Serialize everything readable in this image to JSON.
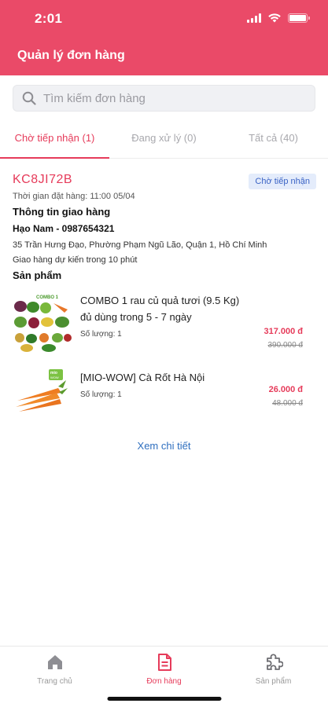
{
  "status_bar": {
    "time": "2:01"
  },
  "header": {
    "title": "Quản lý đơn hàng"
  },
  "search": {
    "placeholder": "Tìm kiếm đơn hàng"
  },
  "tabs": [
    {
      "label": "Chờ tiếp nhận (1)",
      "active": true
    },
    {
      "label": "Đang xử lý (0)",
      "active": false
    },
    {
      "label": "Tất cả (40)",
      "active": false
    }
  ],
  "order": {
    "code": "KC8JI72B",
    "status_badge": "Chờ tiếp nhận",
    "order_time": "Thời gian đặt hàng: 11:00 05/04",
    "delivery_title": "Thông tin giao hàng",
    "customer": "Hạo Nam - 0987654321",
    "address": "35 Trần Hưng Đạo, Phường Phạm Ngũ Lão,  Quận 1, Hồ Chí Minh",
    "eta": "Giao hàng dự kiến trong 10 phút",
    "products_title": "Sản phẩm",
    "products": [
      {
        "name": "COMBO 1 rau củ quả tươi (9.5 Kg) đủ dùng trong 5 - 7 ngày",
        "quantity": "Số lượng: 1",
        "price": "317.000 đ",
        "old_price": "390.000 đ",
        "image_label": "COMBO 1"
      },
      {
        "name": "[MIO-WOW] Cà Rốt Hà Nội",
        "quantity": "Số lượng: 1",
        "price": "26.000 đ",
        "old_price": "48.000 đ",
        "image_label": "mio WOW"
      }
    ],
    "detail_link": "Xem chi tiết"
  },
  "bottom_nav": [
    {
      "label": "Trang chủ",
      "icon": "home-icon",
      "active": false
    },
    {
      "label": "Đơn hàng",
      "icon": "order-document-icon",
      "active": true
    },
    {
      "label": "Sản phẩm",
      "icon": "product-puzzle-icon",
      "active": false
    }
  ],
  "colors": {
    "brand": "#ea4a68",
    "accent": "#e63b5a",
    "link": "#2f6fbf",
    "badge_bg": "#e4ecfb",
    "badge_text": "#3a63c5"
  }
}
